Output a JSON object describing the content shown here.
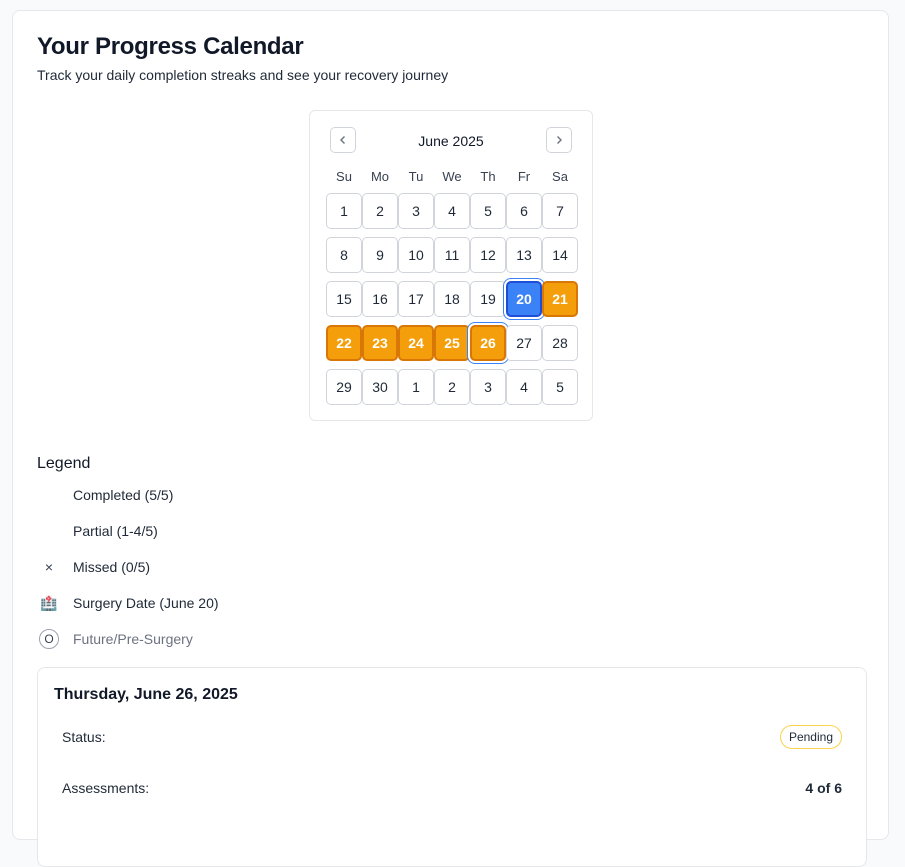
{
  "page": {
    "title": "Your Progress Calendar",
    "subtitle": "Track your daily completion streaks and see your recovery journey"
  },
  "calendar": {
    "month_label": "June 2025",
    "prev_icon": "chevron-left-icon",
    "next_icon": "chevron-right-icon",
    "weekdays": [
      "Su",
      "Mo",
      "Tu",
      "We",
      "Th",
      "Fr",
      "Sa"
    ],
    "days": [
      {
        "label": "1",
        "state": "default"
      },
      {
        "label": "2",
        "state": "default"
      },
      {
        "label": "3",
        "state": "default"
      },
      {
        "label": "4",
        "state": "default"
      },
      {
        "label": "5",
        "state": "default"
      },
      {
        "label": "6",
        "state": "default"
      },
      {
        "label": "7",
        "state": "default"
      },
      {
        "label": "8",
        "state": "default"
      },
      {
        "label": "9",
        "state": "default"
      },
      {
        "label": "10",
        "state": "default"
      },
      {
        "label": "11",
        "state": "default"
      },
      {
        "label": "12",
        "state": "default"
      },
      {
        "label": "13",
        "state": "default"
      },
      {
        "label": "14",
        "state": "default"
      },
      {
        "label": "15",
        "state": "default"
      },
      {
        "label": "16",
        "state": "default"
      },
      {
        "label": "17",
        "state": "default"
      },
      {
        "label": "18",
        "state": "default"
      },
      {
        "label": "19",
        "state": "default"
      },
      {
        "label": "20",
        "state": "surgery"
      },
      {
        "label": "21",
        "state": "partial"
      },
      {
        "label": "22",
        "state": "partial"
      },
      {
        "label": "23",
        "state": "partial"
      },
      {
        "label": "24",
        "state": "partial"
      },
      {
        "label": "25",
        "state": "partial"
      },
      {
        "label": "26",
        "state": "partial selected"
      },
      {
        "label": "27",
        "state": "default"
      },
      {
        "label": "28",
        "state": "default"
      },
      {
        "label": "29",
        "state": "default"
      },
      {
        "label": "30",
        "state": "default"
      },
      {
        "label": "1",
        "state": "default"
      },
      {
        "label": "2",
        "state": "default"
      },
      {
        "label": "3",
        "state": "default"
      },
      {
        "label": "4",
        "state": "default"
      },
      {
        "label": "5",
        "state": "default"
      }
    ]
  },
  "legend": {
    "title": "Legend",
    "items": [
      {
        "icon": "",
        "label": "Completed (5/5)"
      },
      {
        "icon": "×",
        "label": "Missed (0/5)"
      },
      {
        "icon": "🏥",
        "label": "Surgery Date (June 20)"
      },
      {
        "icon": "O",
        "label": "Future/Pre-Surgery"
      }
    ],
    "partial_label": "Partial (1-4/5)"
  },
  "detail": {
    "date": "Thursday, June 26, 2025",
    "status_label": "Status:",
    "status_value": "Pending",
    "assessments_label": "Assessments:",
    "assessments_value": "4 of 6"
  },
  "colors": {
    "partial": "#f59e0b",
    "surgery": "#3b82f6",
    "badge_border": "#fcd34d"
  }
}
